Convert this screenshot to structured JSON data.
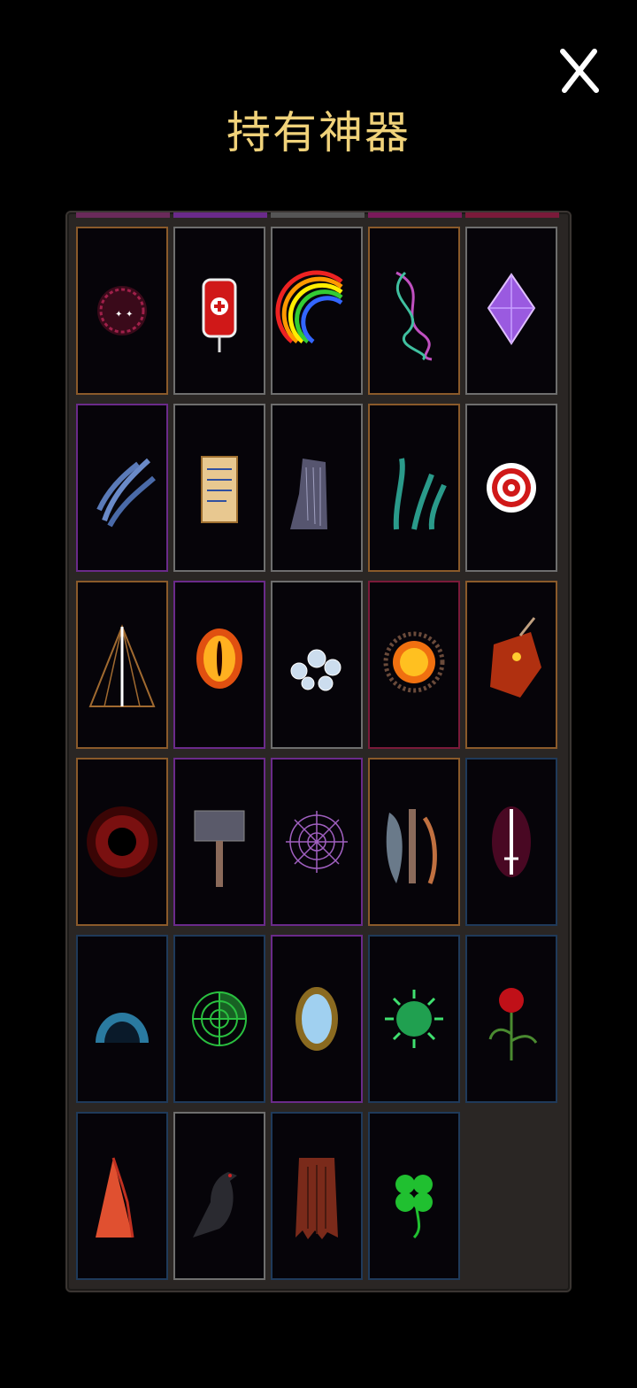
{
  "header": {
    "title": "持有神器",
    "close_icon": "close-x-icon"
  },
  "colors": {
    "title": "#f0d27a",
    "panel": "#2a2624",
    "background": "#000000"
  },
  "artifacts": [
    {
      "icon": "jester-mask-icon",
      "rarity": "orange"
    },
    {
      "icon": "blood-bag-icon",
      "rarity": "gray"
    },
    {
      "icon": "rainbow-icon",
      "rarity": "gray"
    },
    {
      "icon": "dna-helix-icon",
      "rarity": "orange"
    },
    {
      "icon": "purple-crystal-icon",
      "rarity": "gray"
    },
    {
      "icon": "tentacles-icon",
      "rarity": "purple"
    },
    {
      "icon": "scroll-icon",
      "rarity": "gray"
    },
    {
      "icon": "fur-icon",
      "rarity": "gray"
    },
    {
      "icon": "hydra-icon",
      "rarity": "orange"
    },
    {
      "icon": "target-icon",
      "rarity": "gray"
    },
    {
      "icon": "web-spire-icon",
      "rarity": "orange"
    },
    {
      "icon": "fire-eye-icon",
      "rarity": "purple"
    },
    {
      "icon": "bubbles-icon",
      "rarity": "gray"
    },
    {
      "icon": "sun-orb-icon",
      "rarity": "red"
    },
    {
      "icon": "dragon-head-icon",
      "rarity": "orange"
    },
    {
      "icon": "blood-vortex-icon",
      "rarity": "orange"
    },
    {
      "icon": "war-hammer-icon",
      "rarity": "purple"
    },
    {
      "icon": "spider-web-icon",
      "rarity": "purple"
    },
    {
      "icon": "battle-axe-icon",
      "rarity": "orange"
    },
    {
      "icon": "sword-icon",
      "rarity": "blue"
    },
    {
      "icon": "blue-orb-icon",
      "rarity": "blue"
    },
    {
      "icon": "radar-icon",
      "rarity": "blue"
    },
    {
      "icon": "mirror-icon",
      "rarity": "purple"
    },
    {
      "icon": "virus-icon",
      "rarity": "blue"
    },
    {
      "icon": "rose-icon",
      "rarity": "blue"
    },
    {
      "icon": "red-spikes-icon",
      "rarity": "blue"
    },
    {
      "icon": "crow-icon",
      "rarity": "gray"
    },
    {
      "icon": "tattered-cloak-icon",
      "rarity": "blue"
    },
    {
      "icon": "four-leaf-clover-icon",
      "rarity": "blue"
    }
  ]
}
